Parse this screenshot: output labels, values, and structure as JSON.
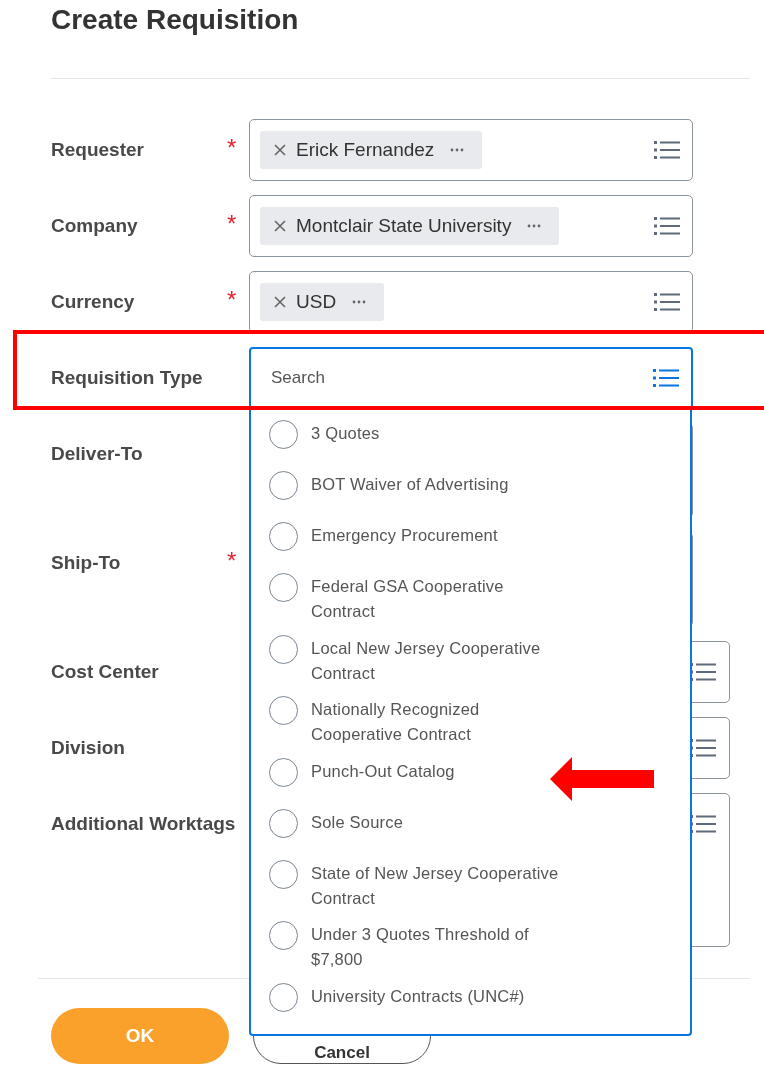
{
  "title": "Create Requisition",
  "fields": [
    {
      "label": "Requester",
      "required_mark": "*",
      "kind": "chip",
      "value": "Erick Fernandez"
    },
    {
      "label": "Company",
      "required_mark": "*",
      "kind": "chip",
      "value": "Montclair State University"
    },
    {
      "label": "Currency",
      "required_mark": "*",
      "kind": "chip",
      "value": "USD"
    },
    {
      "label": "Requisition Type",
      "kind": "search",
      "placeholder": "Search"
    },
    {
      "label": "Deliver-To",
      "kind": "empty"
    },
    {
      "label": "Ship-To",
      "required_mark": "*",
      "kind": "empty"
    },
    {
      "label": "Cost Center",
      "kind": "prompt"
    },
    {
      "label": "Division",
      "kind": "prompt"
    },
    {
      "label": "Additional Worktags",
      "kind": "multi"
    }
  ],
  "dropdown": {
    "options": [
      {
        "label": "3 Quotes",
        "selected": false
      },
      {
        "label": "BOT Waiver of Advertising",
        "selected": false
      },
      {
        "label": "Emergency Procurement",
        "selected": false
      },
      {
        "label": "Federal GSA Cooperative Contract",
        "selected": false
      },
      {
        "label": "Local New Jersey Cooperative Contract",
        "selected": false
      },
      {
        "label": "Nationally Recognized Cooperative Contract",
        "selected": false
      },
      {
        "label": "Punch-Out Catalog",
        "selected": false
      },
      {
        "label": "Sole Source",
        "selected": false
      },
      {
        "label": "State of New Jersey Cooperative Contract",
        "selected": false
      },
      {
        "label": "Under 3 Quotes Threshold of $7,800",
        "selected": false
      },
      {
        "label": "University Contracts (UNC#)",
        "selected": false
      }
    ]
  },
  "buttons": [
    {
      "label": "OK",
      "kind": "primary"
    },
    {
      "label": "Cancel",
      "kind": "secondary"
    }
  ]
}
